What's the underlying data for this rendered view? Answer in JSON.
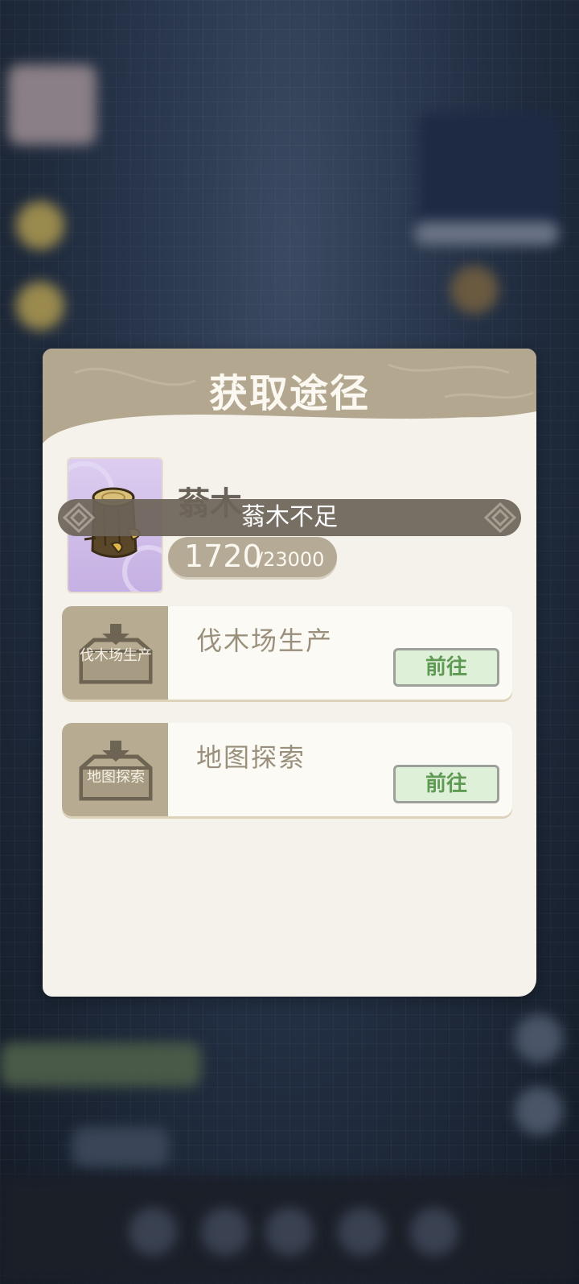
{
  "dialog": {
    "title": "获取途径"
  },
  "item": {
    "name": "蓊木",
    "count_current": "1720",
    "count_total": "/23000",
    "icon": "wood-stump-icon"
  },
  "toast": {
    "message": "蓊木不足"
  },
  "sources": [
    {
      "icon_label": "伐木场生产",
      "title": "伐木场生产",
      "button_label": "前往"
    },
    {
      "icon_label": "地图探索",
      "title": "地图探索",
      "button_label": "前往"
    }
  ],
  "colors": {
    "header": "#b3a78f",
    "dialog_bg": "#f5f2ec",
    "item_card": "#cdb9e8",
    "button_bg": "#dff0d9",
    "button_text": "#5f9a55"
  }
}
